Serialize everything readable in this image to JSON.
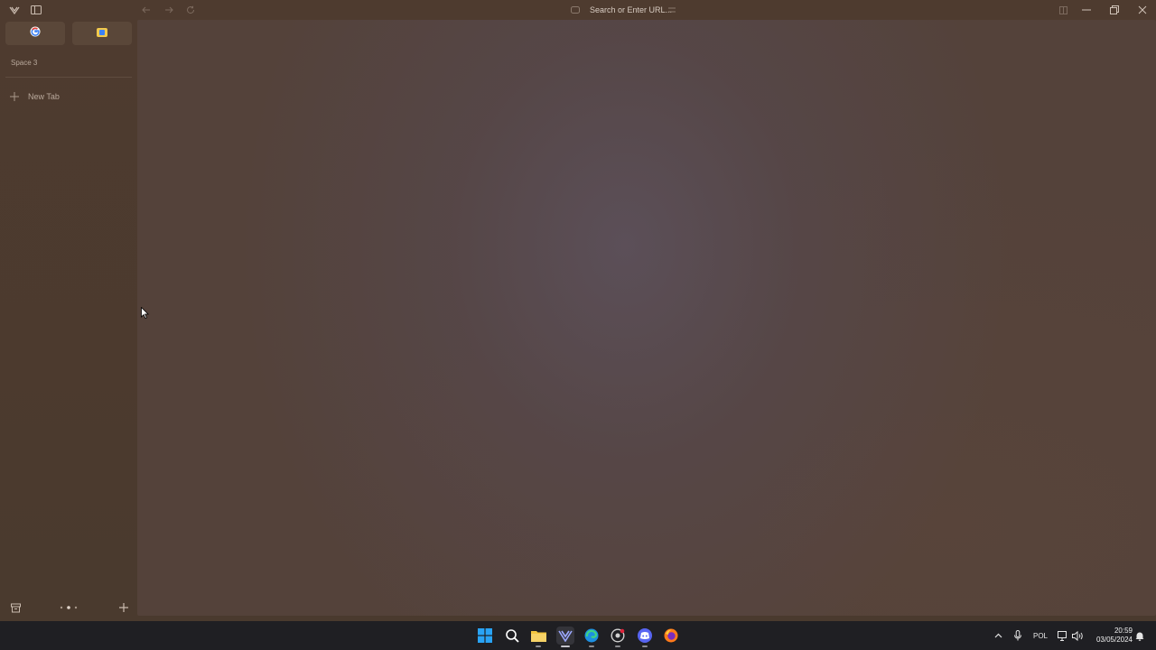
{
  "titlebar": {
    "address_placeholder": "Search or Enter URL..."
  },
  "sidebar": {
    "space_title": "Space 3",
    "new_tab_label": "New Tab"
  },
  "taskbar": {
    "language": "POL",
    "time": "20:59",
    "date": "03/05/2024"
  },
  "colors": {
    "sidebar_bg": "#4e3b2f",
    "taskbar_bg": "#1f1f23",
    "accent_windows": "#29a3f5"
  }
}
